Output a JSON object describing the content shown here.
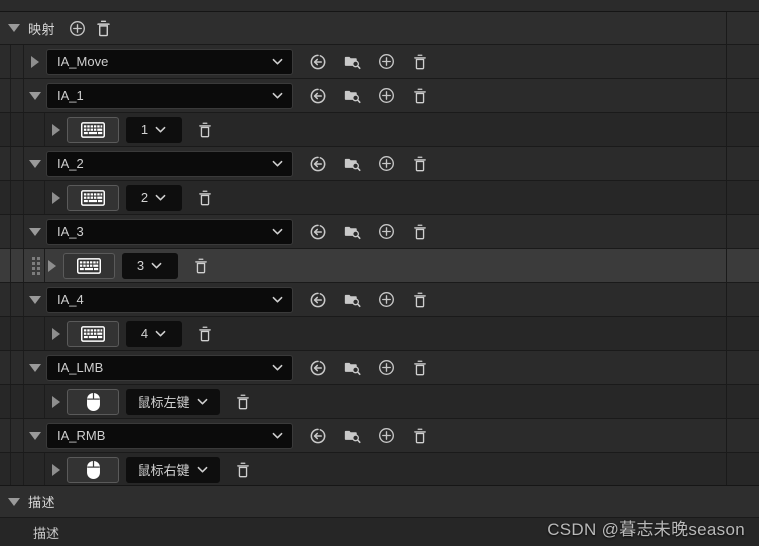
{
  "sections": {
    "mapping": {
      "title": "映射",
      "add_label": "plus-circle-icon",
      "clear_label": "trash-icon"
    },
    "description": {
      "title": "描述",
      "field_label": "描述"
    }
  },
  "row_tools": {
    "browse_label": "browse-to-asset-icon",
    "find_label": "find-in-content-browser-icon",
    "add_label": "add-trigger-icon",
    "delete_label": "delete-icon"
  },
  "mappings": [
    {
      "action": "IA_Move",
      "expanded": false,
      "children": []
    },
    {
      "action": "IA_1",
      "expanded": true,
      "children": [
        {
          "device": "keyboard-icon",
          "key": "1",
          "selected": false
        }
      ]
    },
    {
      "action": "IA_2",
      "expanded": true,
      "children": [
        {
          "device": "keyboard-icon",
          "key": "2",
          "selected": false
        }
      ]
    },
    {
      "action": "IA_3",
      "expanded": true,
      "children": [
        {
          "device": "keyboard-icon",
          "key": "3",
          "selected": true
        }
      ]
    },
    {
      "action": "IA_4",
      "expanded": true,
      "children": [
        {
          "device": "keyboard-icon",
          "key": "4",
          "selected": false
        }
      ]
    },
    {
      "action": "IA_LMB",
      "expanded": true,
      "children": [
        {
          "device": "mouse-icon",
          "key": "鼠标左键",
          "selected": false
        }
      ]
    },
    {
      "action": "IA_RMB",
      "expanded": true,
      "children": [
        {
          "device": "mouse-icon",
          "key": "鼠标右键",
          "selected": false
        }
      ]
    }
  ],
  "watermark": "CSDN @暮志未晚season",
  "colors": {
    "panel_bg": "#242424",
    "parent_row": "#2b2b2b",
    "child_row": "#272727",
    "selected_row": "#3b3b3b",
    "combo_bg": "#0b0b0b",
    "text": "#cfcfcf"
  }
}
